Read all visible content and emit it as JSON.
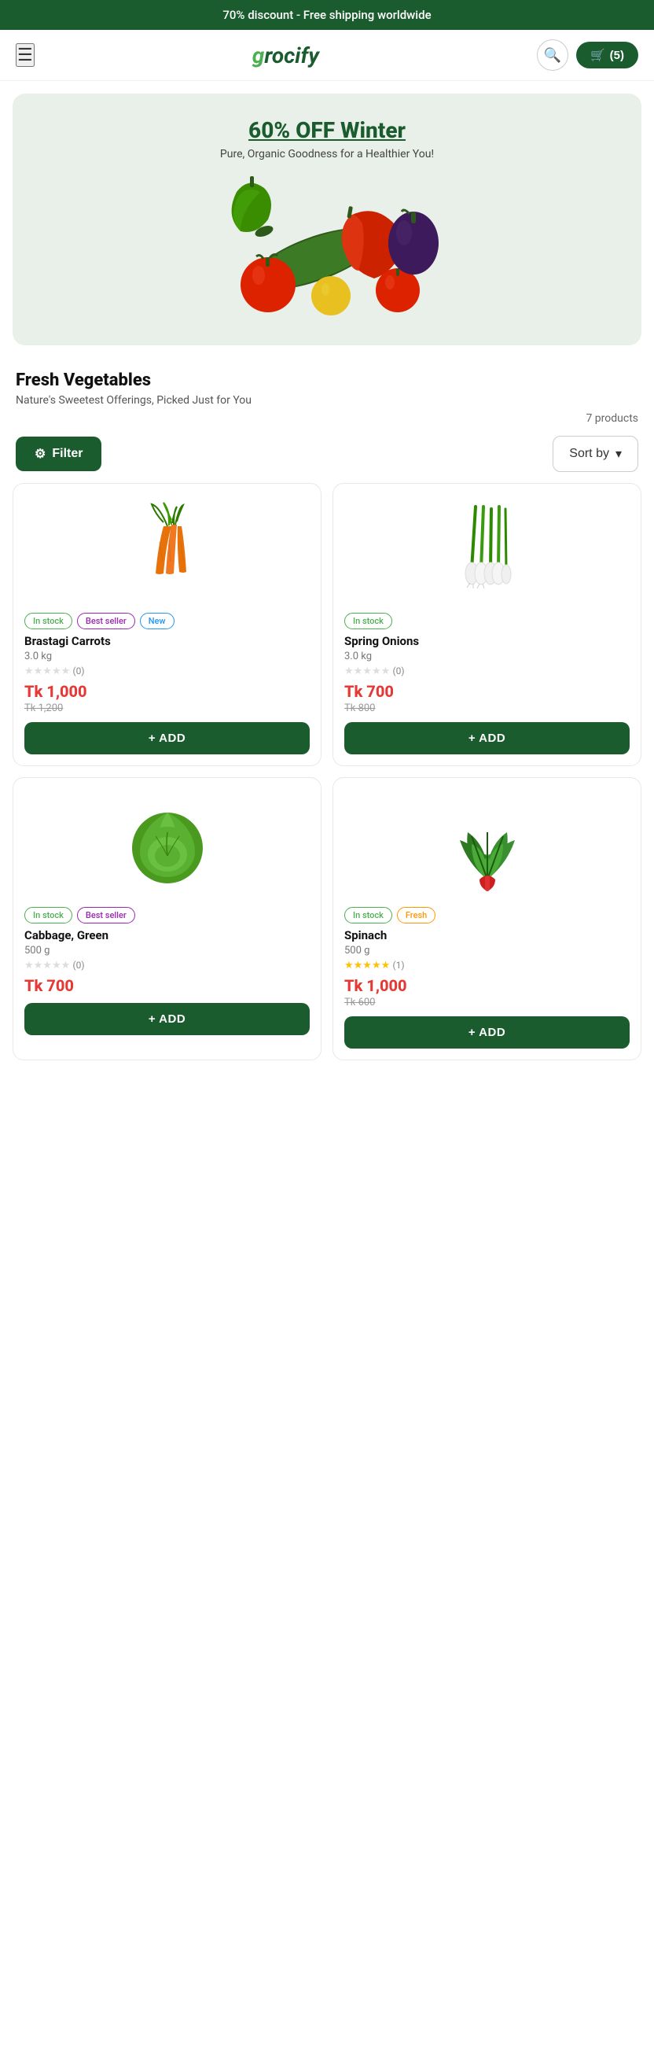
{
  "banner": {
    "text": "70% discount - Free shipping worldwide"
  },
  "header": {
    "logo": "grocify",
    "search_label": "search",
    "cart_label": "🛒 (5)"
  },
  "hero": {
    "title": "60% OFF Winter",
    "subtitle": "Pure, Organic Goodness for a Healthier You!"
  },
  "section": {
    "title": "Fresh Vegetables",
    "description": "Nature's Sweetest Offerings, Picked Just for You",
    "product_count": "7 products"
  },
  "filter_bar": {
    "filter_label": "Filter",
    "sort_label": "Sort by"
  },
  "products": [
    {
      "id": 1,
      "name": "Brastagi Carrots",
      "weight": "3.0 kg",
      "price": "Tk 1,000",
      "original_price": "Tk 1,200",
      "rating": 0,
      "review_count": 0,
      "badges": [
        "In stock",
        "Best seller",
        "New"
      ],
      "add_label": "+ ADD"
    },
    {
      "id": 2,
      "name": "Spring Onions",
      "weight": "3.0 kg",
      "price": "Tk 700",
      "original_price": "Tk 800",
      "rating": 0,
      "review_count": 0,
      "badges": [
        "In stock"
      ],
      "add_label": "+ ADD"
    },
    {
      "id": 3,
      "name": "Cabbage, Green",
      "weight": "500 g",
      "price": "Tk 700",
      "original_price": null,
      "rating": 0,
      "review_count": 0,
      "badges": [
        "In stock",
        "Best seller"
      ],
      "add_label": "+ ADD"
    },
    {
      "id": 4,
      "name": "Spinach",
      "weight": "500 g",
      "price": "Tk 1,000",
      "original_price": "Tk 600",
      "rating": 5,
      "review_count": 1,
      "badges": [
        "In stock",
        "Fresh"
      ],
      "add_label": "+ ADD"
    }
  ]
}
